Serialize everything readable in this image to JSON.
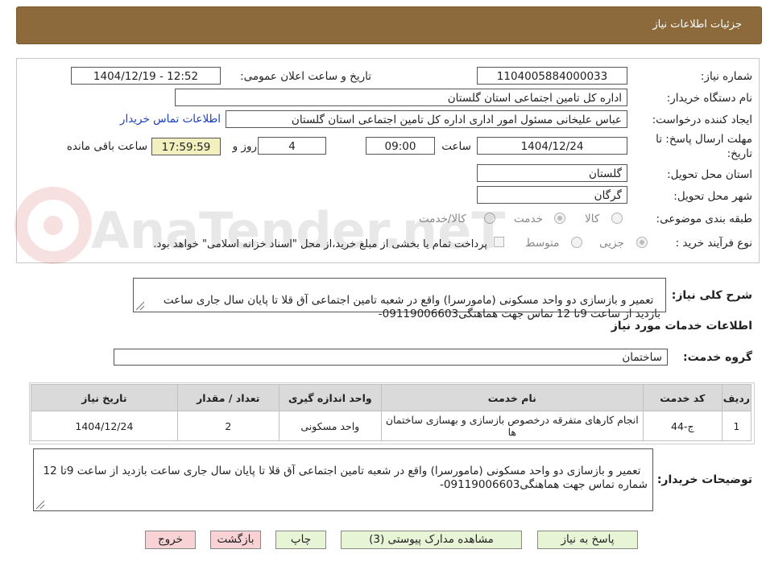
{
  "header": {
    "title": "جزئیات اطلاعات نیاز"
  },
  "form": {
    "need_number_label": "شماره نیاز:",
    "need_number": "1104005884000033",
    "announce_label": "تاریخ و ساعت اعلان عمومی:",
    "announce_value": "1404/12/19 - 12:52",
    "buyer_org_label": "نام دستگاه خریدار:",
    "buyer_org": "اداره کل تامین اجتماعی استان گلستان",
    "requester_label": "ایجاد کننده درخواست:",
    "requester": "عباس علیخانی مسئول امور اداری اداره کل تامین اجتماعی استان گلستان",
    "contact_link": "اطلاعات تماس خریدار",
    "deadline_label_1": "مهلت ارسال پاسخ: تا",
    "deadline_label_2": "تاریخ:",
    "deadline_date": "1404/12/24",
    "time_label": "ساعت",
    "deadline_time": "09:00",
    "days_value": "4",
    "days_label": "روز و",
    "remaining_time": "17:59:59",
    "remaining_label": "ساعت باقی مانده",
    "province_label": "استان محل تحویل:",
    "province": "گلستان",
    "city_label": "شهر محل تحویل:",
    "city": "گرگان",
    "category_label": "طبقه بندی موضوعی:",
    "category_options": [
      "کالا",
      "خدمت",
      "کالا/خدمت"
    ],
    "category_selected": "خدمت",
    "process_label": "نوع فرآیند خرید :",
    "process_options": [
      "جزیی",
      "متوسط"
    ],
    "process_selected": "جزیی",
    "payment_note": "پرداخت تمام یا بخشی از مبلغ خرید،از محل \"اسناد خزانه اسلامی\" خواهد بود."
  },
  "description": {
    "label": "شرح کلی نیاز:",
    "text": "تعمیر و بازسازی دو واحد مسکونی (مامورسرا) واقع در شعبه تامین اجتماعی آق قلا تا پایان سال جاری ساعت بازدید از ساعت 9تا 12 تماس جهت هماهنگی09119006603-"
  },
  "services": {
    "section_title": "اطلاعات خدمات مورد نیاز",
    "group_label": "گروه خدمت:",
    "group_value": "ساختمان",
    "columns": [
      "ردیف",
      "کد خدمت",
      "نام خدمت",
      "واحد اندازه گیری",
      "تعداد / مقدار",
      "تاریخ نیاز"
    ],
    "rows": [
      [
        "1",
        "ج-44",
        "انجام کارهای متفرقه درخصوص بازسازی و بهسازی ساختمان ها",
        "واحد مسکونی",
        "2",
        "1404/12/24"
      ]
    ]
  },
  "buyer_notes": {
    "label": "توضیحات خریدار:",
    "text": "تعمیر و بازسازی دو واحد مسکونی (مامورسرا) واقع در شعبه تامین اجتماعی آق قلا تا پایان سال جاری ساعت بازدید از ساعت 9تا 12 شماره تماس جهت هماهنگی09119006603-"
  },
  "buttons": {
    "reply": "پاسخ به نیاز",
    "attachments": "مشاهده مدارک پیوستی (3)",
    "print": "چاپ",
    "back": "بازگشت",
    "exit": "خروج"
  },
  "watermark_text": "AnaTender.neT",
  "colors": {
    "title_bar": "#8c6a3b",
    "link": "#1a3fbf",
    "remaining_bg": "#f3f0bf",
    "green_button": "#e8f4d6",
    "pink_button": "#f9d2d5",
    "table_header": "#dadada"
  }
}
